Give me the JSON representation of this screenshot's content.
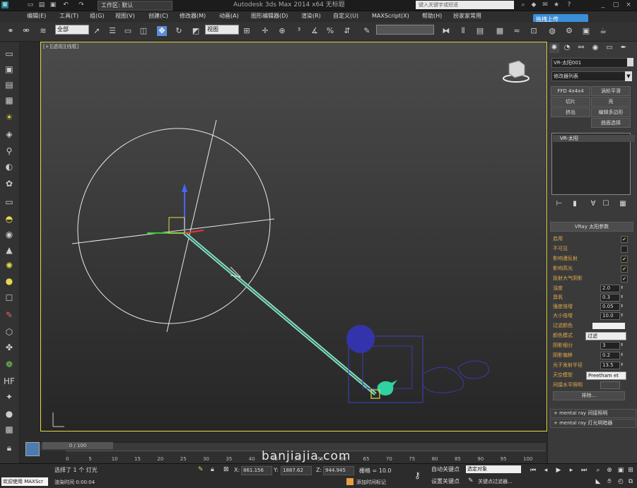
{
  "titlebar": {
    "workspace": "工作区: 默认",
    "app_title": "Autodesk 3ds Max  2014 x64     无标题",
    "search_placeholder": "键入关键字或短语"
  },
  "menu": [
    "编辑(E)",
    "工具(T)",
    "组(G)",
    "视图(V)",
    "创建(C)",
    "修改器(M)",
    "动画(A)",
    "图形编辑器(D)",
    "渲染(R)",
    "自定义(U)",
    "MAXScript(X)",
    "帮助(H)",
    "扮家家常用"
  ],
  "upload_button": "拖拽上传",
  "toolbar": {
    "selection_filter": "全部",
    "reference_coord": "视图"
  },
  "viewport": {
    "label": "[+][透视][线框]",
    "watermark": "banjiajia.com"
  },
  "command_panel": {
    "object_name": "VR-太阳001",
    "modifier_list": "修改器列表",
    "modifier_buttons": [
      {
        "label": "FFD 4x4x4"
      },
      {
        "label": "涡轮平滑"
      },
      {
        "label": "切片"
      },
      {
        "label": "壳"
      },
      {
        "label": "挤出"
      },
      {
        "label": "编辑多边形"
      },
      {
        "label": "曲面选择"
      }
    ],
    "stack_item": "VR-太阳",
    "rollout_title": "VRay 太阳参数",
    "params": {
      "enabled": "启用",
      "invisible": "不可见",
      "affect_diffuse": "影响漫反射",
      "affect_specular": "影响高光",
      "cast_atmos_shadows": "投射大气阴影",
      "turbidity": "浊度",
      "turbidity_val": "2.0",
      "ozone": "臭氧",
      "ozone_val": "0.3",
      "intensity_mult": "强度倍增",
      "intensity_mult_val": "0.05",
      "size_mult": "大小倍增",
      "size_mult_val": "10.0",
      "filter_color": "过滤颜色",
      "color_mode": "颜色模式",
      "color_mode_val": "过滤",
      "shadow_subdivs": "阴影细分",
      "shadow_subdivs_val": "3",
      "shadow_bias": "阴影偏移",
      "shadow_bias_val": "0.2",
      "photon_radius": "光子发射半径",
      "photon_radius_val": "13.5",
      "sky_model": "天空模型",
      "sky_model_val": "Preetham et",
      "indirect_horiz": "间接水平照明",
      "exclude": "排除..."
    },
    "collapsed_rollouts": [
      "mental ray 间接照明",
      "mental ray 灯光明暗器"
    ]
  },
  "timeline": {
    "frame_indicator": "0 / 100",
    "ticks": [
      "0",
      "5",
      "10",
      "15",
      "20",
      "25",
      "30",
      "35",
      "40",
      "45",
      "50",
      "55",
      "60",
      "65",
      "70",
      "75",
      "80",
      "85",
      "90",
      "95",
      "100"
    ]
  },
  "statusbar": {
    "maxscript": "欢迎使用 MAXScr",
    "status_selected": "选择了 1 个 灯光",
    "status_render": "渲染时间  0:00:04",
    "x_label": "X:",
    "x_val": "861.156",
    "y_label": "Y:",
    "y_val": "1887.62",
    "z_label": "Z:",
    "z_val": "944.945",
    "grid": "栅格 = 10.0",
    "add_time_tag": "添加时间标记",
    "auto_key": "自动关键点",
    "set_key": "设置关键点",
    "selected_object": "选定对象",
    "key_filters": "关键点过滤器..."
  }
}
